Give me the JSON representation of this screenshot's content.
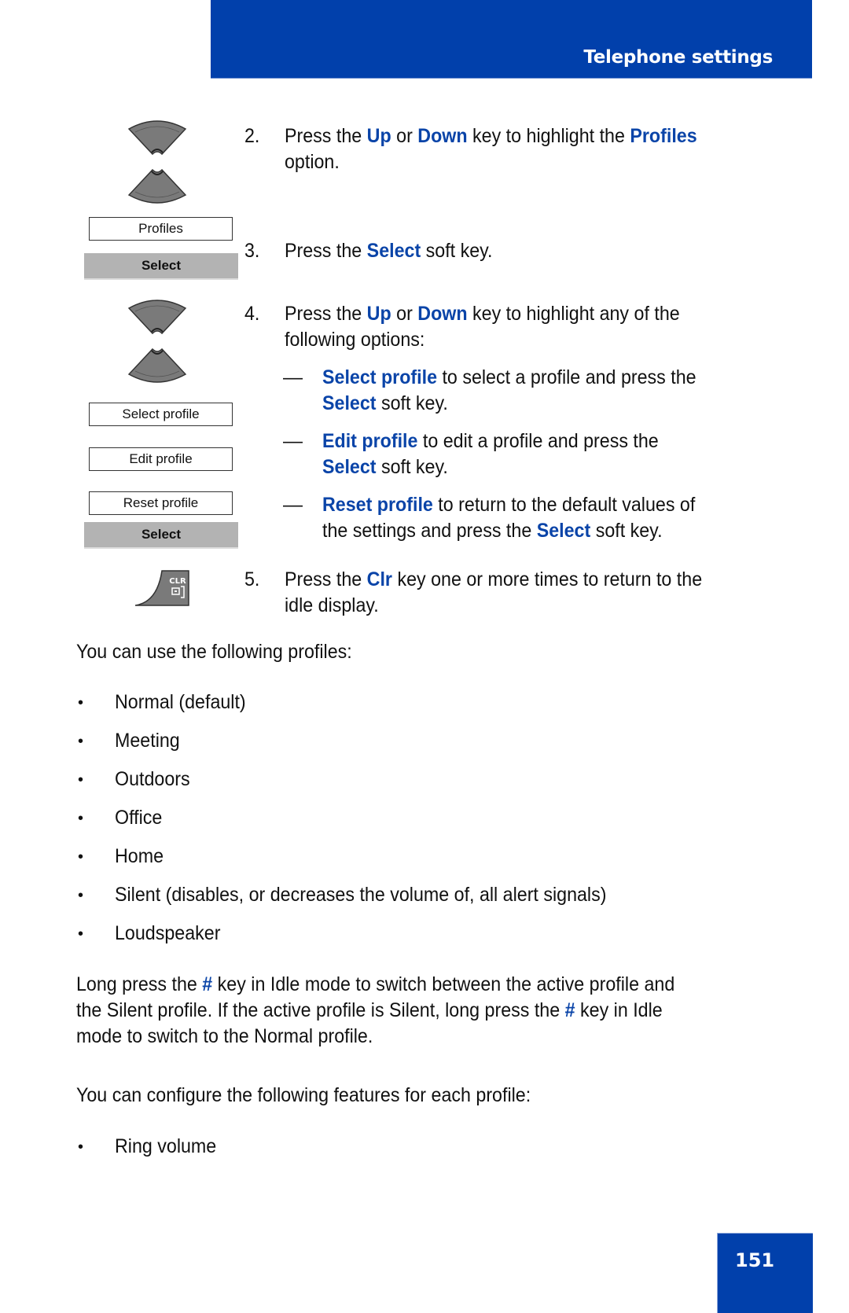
{
  "header": {
    "section_title": "Telephone settings"
  },
  "page_number": "151",
  "colors": {
    "brand_blue": "#0140ab",
    "keyword_blue": "#0a44a8",
    "softkey_gray": "#b3b3b3",
    "key_gray": "#7a7a7a"
  },
  "illustrations": {
    "nav_key_1": {
      "icon": "up-down-navigation-key-icon"
    },
    "screen_1": {
      "items": [
        "Profiles"
      ],
      "softkey": "Select"
    },
    "nav_key_2": {
      "icon": "up-down-navigation-key-icon"
    },
    "screen_2": {
      "items": [
        "Select profile",
        "Edit profile",
        "Reset profile"
      ],
      "softkey": "Select"
    },
    "clr_key": {
      "icon": "clear-key-icon",
      "label": "CLR"
    }
  },
  "steps": [
    {
      "number": "2.",
      "line1": {
        "t1": "Press the ",
        "k1": "Up",
        "t2": " or ",
        "k2": "Down",
        "t3": " key to highlight the ",
        "k3": "Profiles"
      },
      "line2": "option."
    },
    {
      "number": "3.",
      "line1": {
        "t1": "Press the ",
        "k1": "Select",
        "t2": " soft key."
      }
    },
    {
      "number": "4.",
      "line1": {
        "t1": "Press the ",
        "k1": "Up",
        "t2": " or ",
        "k2": "Down",
        "t3": " key to highlight any of the"
      },
      "line2": "following options:",
      "options": [
        {
          "dash": "—",
          "keyword": "Select profile",
          "text": " to select a profile and press the",
          "line2_keyword": "Select",
          "line2_text": " soft key."
        },
        {
          "dash": "—",
          "keyword": "Edit profile",
          "text": " to edit a profile and press the",
          "line2_keyword": "Select",
          "line2_text": " soft key."
        },
        {
          "dash": "—",
          "keyword": "Reset profile",
          "text": " to return to the default values of",
          "line2_pre": "the settings and press the ",
          "line2_keyword": "Select",
          "line2_text": " soft key."
        }
      ]
    },
    {
      "number": "5.",
      "line1": {
        "t1": "Press the ",
        "k1": "Clr",
        "t2": " key one or more times to return to the"
      },
      "line2": "idle display."
    }
  ],
  "profiles_intro": "You can use the following profiles:",
  "profiles": [
    "Normal (default)",
    "Meeting",
    "Outdoors",
    "Office",
    "Home",
    "Silent (disables, or decreases the volume of, all alert signals)",
    "Loudspeaker"
  ],
  "bullet_char": "•",
  "long_press": {
    "l1_a": "Long press the ",
    "l1_key": "#",
    "l1_b": " key in Idle mode to switch between the active profile and",
    "l2_a": "the Silent profile. If the active profile is Silent, long press the ",
    "l2_key": "#",
    "l2_b": " key in Idle",
    "l3": "mode to switch to the Normal profile."
  },
  "features_intro": "You can configure the following features for each profile:",
  "features": [
    "Ring volume"
  ]
}
